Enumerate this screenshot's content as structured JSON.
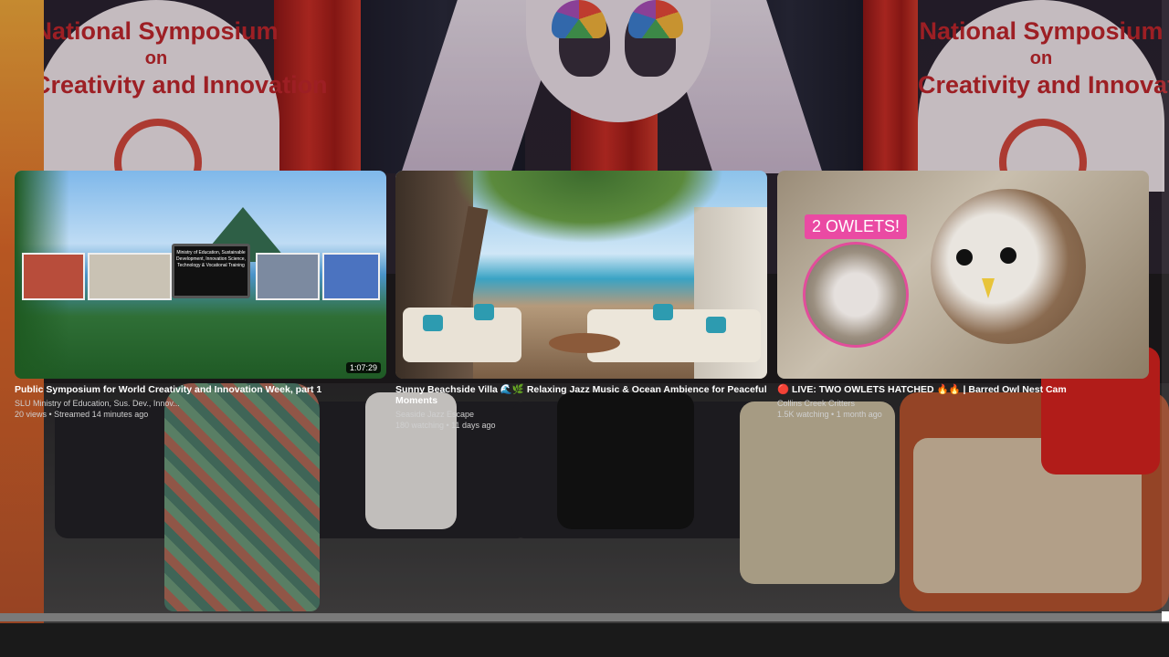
{
  "background": {
    "banner_left": {
      "line1": "National Symposium",
      "line2": "on",
      "line3": "Creativity and Innovation"
    },
    "banner_right": {
      "line1": "National Symposium",
      "line2": "on",
      "line3": "Creativity and Innovatio"
    }
  },
  "endscreen": {
    "cards": [
      {
        "title": "Public Symposium for World Creativity and Innovation Week, part 1",
        "channel": "SLU Ministry of Education, Sus. Dev., Innov...",
        "meta": "20 views • Streamed 14 minutes ago",
        "duration": "1:07:29",
        "thumb_text": "Ministry of Education, Sustainable Development, Innovation Science, Technology & Vocational Training"
      },
      {
        "title": "Sunny Beachside Villa 🌊🌿 Relaxing Jazz Music & Ocean Ambience for Peaceful Moments",
        "channel": "Seaside Jazz Escape",
        "meta": "180 watching • 11 days ago"
      },
      {
        "title": "🔴 LIVE: TWO OWLETS HATCHED 🔥🔥 | Barred Owl Nest Cam",
        "channel": "Collins Creek Critters",
        "meta": "1.5K watching • 1 month ago",
        "badge": "2 OWLETS!"
      }
    ]
  },
  "player": {
    "progress": 0.994,
    "colors": {
      "progress": "#7a7a7a",
      "bar": "#1a1a1a"
    }
  }
}
